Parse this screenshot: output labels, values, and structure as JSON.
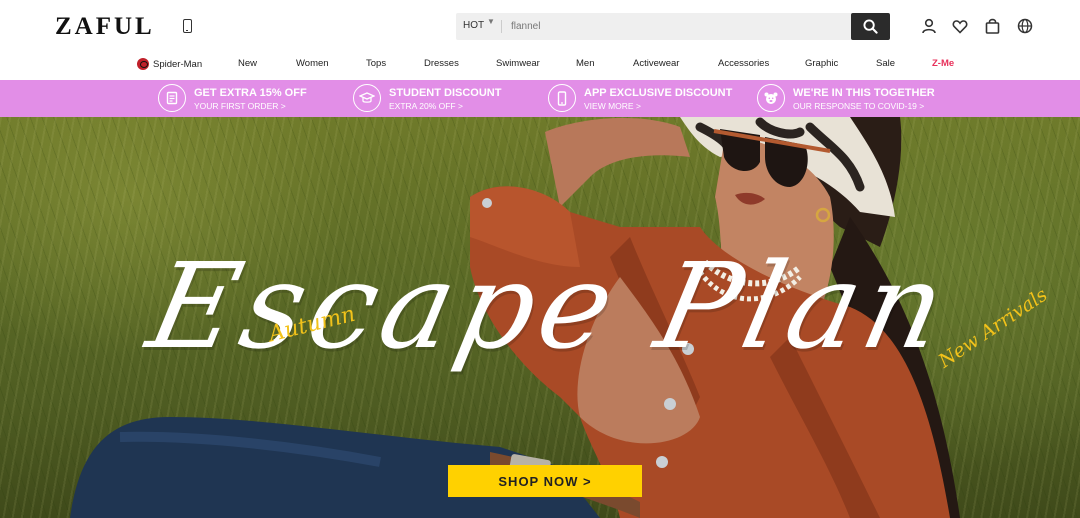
{
  "header": {
    "logo": "ZAFUL",
    "search": {
      "category": "HOT",
      "placeholder": "flannel"
    }
  },
  "nav": {
    "items": [
      {
        "label": "Spider-Man"
      },
      {
        "label": "New"
      },
      {
        "label": "Women"
      },
      {
        "label": "Tops"
      },
      {
        "label": "Dresses"
      },
      {
        "label": "Swimwear"
      },
      {
        "label": "Men"
      },
      {
        "label": "Activewear"
      },
      {
        "label": "Accessories"
      },
      {
        "label": "Graphic"
      },
      {
        "label": "Sale"
      },
      {
        "label": "Z-Me"
      }
    ]
  },
  "promo": {
    "items": [
      {
        "icon": "coupon-icon",
        "title": "GET EXTRA 15% OFF",
        "sub": "YOUR FIRST ORDER >"
      },
      {
        "icon": "graduation-cap-icon",
        "title": "STUDENT DISCOUNT",
        "sub": "EXTRA 20% OFF >"
      },
      {
        "icon": "phone-icon",
        "title": "APP EXCLUSIVE DISCOUNT",
        "sub": "VIEW MORE >"
      },
      {
        "icon": "bear-icon",
        "title": "WE'RE IN THIS TOGETHER",
        "sub": "OUR RESPONSE TO COVID-19 >"
      }
    ]
  },
  "hero": {
    "title": "Escape Plan",
    "tag_left": "Autumn",
    "tag_right": "New Arrivals",
    "cta": "SHOP NOW >"
  },
  "colors": {
    "promo_bg": "#e28ee7",
    "cta_bg": "#ffd100",
    "accent_yellow": "#f2c21a",
    "zme_red": "#e8315b"
  }
}
